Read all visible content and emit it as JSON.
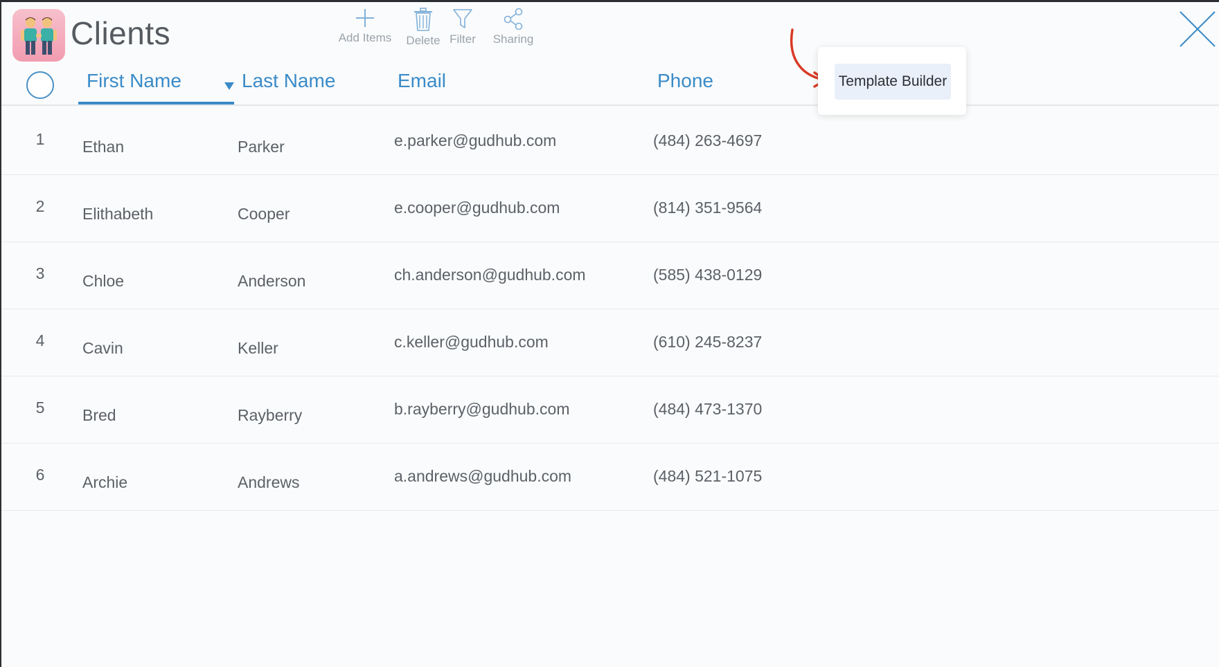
{
  "app": {
    "title": "Clients"
  },
  "toolbar": {
    "add_label": "Add Items",
    "delete_label": "Delete",
    "filter_label": "Filter",
    "sharing_label": "Sharing"
  },
  "columns": {
    "first_name": "First Name",
    "last_name": "Last Name",
    "email": "Email",
    "phone": "Phone"
  },
  "popup": {
    "template_builder_label": "Template Builder"
  },
  "rows": [
    {
      "num": "1",
      "first": "Ethan",
      "last": "Parker",
      "email": "e.parker@gudhub.com",
      "phone": "(484) 263-4697"
    },
    {
      "num": "2",
      "first": "Elithabeth",
      "last": "Cooper",
      "email": "e.cooper@gudhub.com",
      "phone": "(814) 351-9564"
    },
    {
      "num": "3",
      "first": "Chloe",
      "last": "Anderson",
      "email": "ch.anderson@gudhub.com",
      "phone": "(585) 438-0129"
    },
    {
      "num": "4",
      "first": "Cavin",
      "last": "Keller",
      "email": "c.keller@gudhub.com",
      "phone": "(610) 245-8237"
    },
    {
      "num": "5",
      "first": "Bred",
      "last": "Rayberry",
      "email": "b.rayberry@gudhub.com",
      "phone": "(484) 473-1370"
    },
    {
      "num": "6",
      "first": "Archie",
      "last": "Andrews",
      "email": "a.andrews@gudhub.com",
      "phone": "(484) 521-1075"
    }
  ],
  "colors": {
    "accent": "#3a8bc8",
    "annotation_arrow": "#d93a26",
    "icon_gray": "#9aa3ab"
  },
  "icons": {
    "app": "two-people-icon",
    "add": "plus-icon",
    "delete": "trash-icon",
    "filter": "funnel-icon",
    "sharing": "share-icon",
    "close": "close-icon"
  }
}
